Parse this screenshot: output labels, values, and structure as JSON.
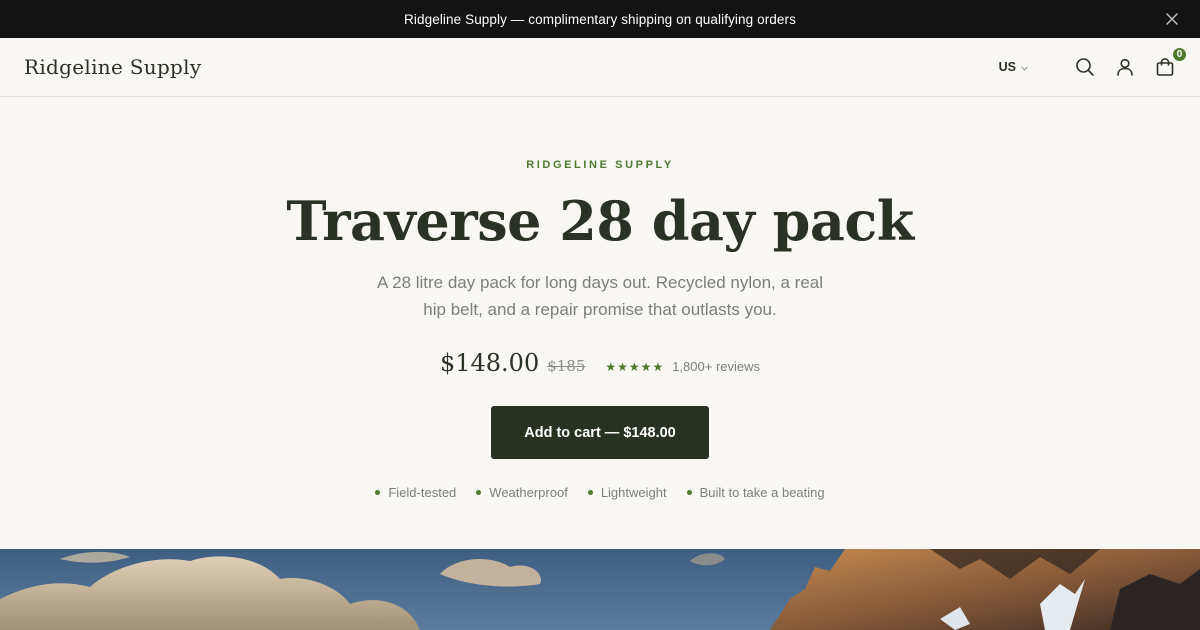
{
  "announcement": {
    "text": "Ridgeline Supply — complimentary shipping on qualifying orders"
  },
  "header": {
    "logo": "Ridgeline Supply",
    "currency": "US",
    "cart_count": "0",
    "icons": [
      "search-icon",
      "account-icon",
      "cart-icon",
      "close-icon",
      "chevron-down-icon"
    ]
  },
  "hero": {
    "eyebrow": "RIDGELINE SUPPLY",
    "title": "Traverse 28 day pack",
    "subtitle": "A 28 litre day pack for long days out. Recycled nylon, a real hip belt, and a repair promise that outlasts you.",
    "price": "$148.00",
    "compare_price": "$185",
    "stars": "★★★★★",
    "reviews": "1,800+ reviews",
    "cta": "Add to cart — $148.00",
    "features": [
      "Field-tested",
      "Weatherproof",
      "Lightweight",
      "Built to take a beating"
    ]
  },
  "colors": {
    "accent": "#4f7a2e",
    "button": "#283222",
    "background": "#f9f7f3",
    "announcement_bg": "#131313"
  }
}
